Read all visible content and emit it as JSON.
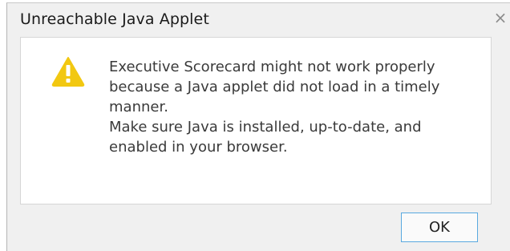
{
  "dialog": {
    "title": "Unreachable Java Applet",
    "close_glyph": "×",
    "icon": "warning-triangle-icon",
    "message_lines": [
      "Executive Scorecard might not work properly because a Java applet did not load in a timely manner.",
      "Make sure Java is installed, up-to-date, and enabled in your browser."
    ],
    "ok_label": "OK"
  },
  "colors": {
    "warning_yellow": "#f2c811",
    "button_border": "#59a9e0"
  }
}
